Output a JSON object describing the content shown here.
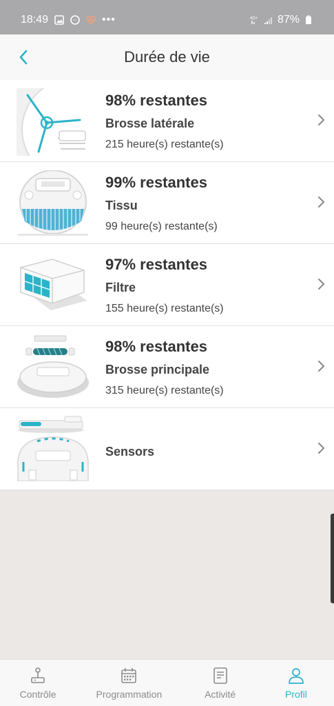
{
  "status_bar": {
    "time": "18:49",
    "battery": "87%",
    "left_icons": [
      "image-icon",
      "messenger-icon",
      "health-icon",
      "more-icon"
    ],
    "right_icons": [
      "wifi-calling-icon",
      "signal-icon",
      "battery-icon"
    ]
  },
  "header": {
    "title": "Durée de vie",
    "back_icon": "chevron-left-icon"
  },
  "components": [
    {
      "id": "brosse-laterale",
      "remaining": "98% restantes",
      "name": "Brosse latérale",
      "hours": "215 heure(s) restante(s)",
      "thumb_icon": "side-brush-image"
    },
    {
      "id": "tissu",
      "remaining": "99% restantes",
      "name": "Tissu",
      "hours": "99 heure(s) restante(s)",
      "thumb_icon": "mop-cloth-image"
    },
    {
      "id": "filtre",
      "remaining": "97% restantes",
      "name": "Filtre",
      "hours": "155 heure(s) restante(s)",
      "thumb_icon": "filter-image"
    },
    {
      "id": "brosse-principale",
      "remaining": "98% restantes",
      "name": "Brosse principale",
      "hours": "315 heure(s) restante(s)",
      "thumb_icon": "main-brush-image"
    },
    {
      "id": "sensors",
      "name": "Sensors",
      "thumb_icon": "sensors-image"
    }
  ],
  "bottom_nav": [
    {
      "label": "Contrôle",
      "icon": "joystick-icon",
      "active": false
    },
    {
      "label": "Programmation",
      "icon": "calendar-icon",
      "active": false
    },
    {
      "label": "Activité",
      "icon": "document-icon",
      "active": false
    },
    {
      "label": "Profil",
      "icon": "person-icon",
      "active": true
    }
  ],
  "colors": {
    "accent": "#2bb3c9",
    "text": "#333333",
    "muted": "#8a8a8a",
    "background": "#ebe8e6"
  }
}
